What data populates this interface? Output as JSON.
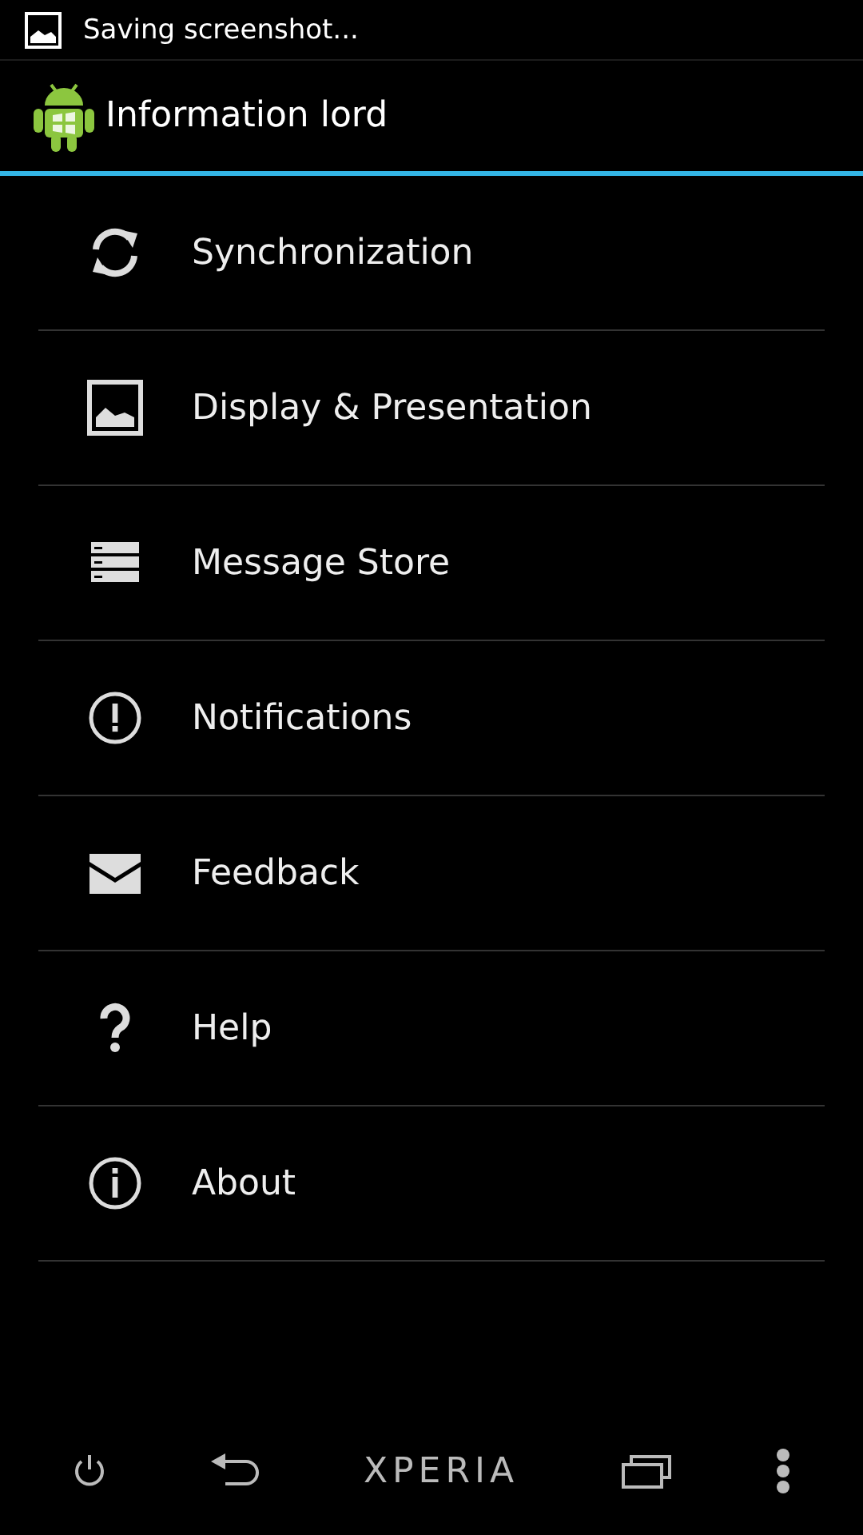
{
  "status_bar": {
    "notification": "Saving screenshot..."
  },
  "action_bar": {
    "title": "Information lord"
  },
  "menu": [
    {
      "label": "Synchronization",
      "kind": "sync"
    },
    {
      "label": "Display & Presentation",
      "kind": "image"
    },
    {
      "label": "Message Store",
      "kind": "storage"
    },
    {
      "label": "Notifications",
      "kind": "alert"
    },
    {
      "label": "Feedback",
      "kind": "mail"
    },
    {
      "label": "Help",
      "kind": "help"
    },
    {
      "label": "About",
      "kind": "info"
    }
  ],
  "nav_bar": {
    "brand": "XPERIA"
  }
}
